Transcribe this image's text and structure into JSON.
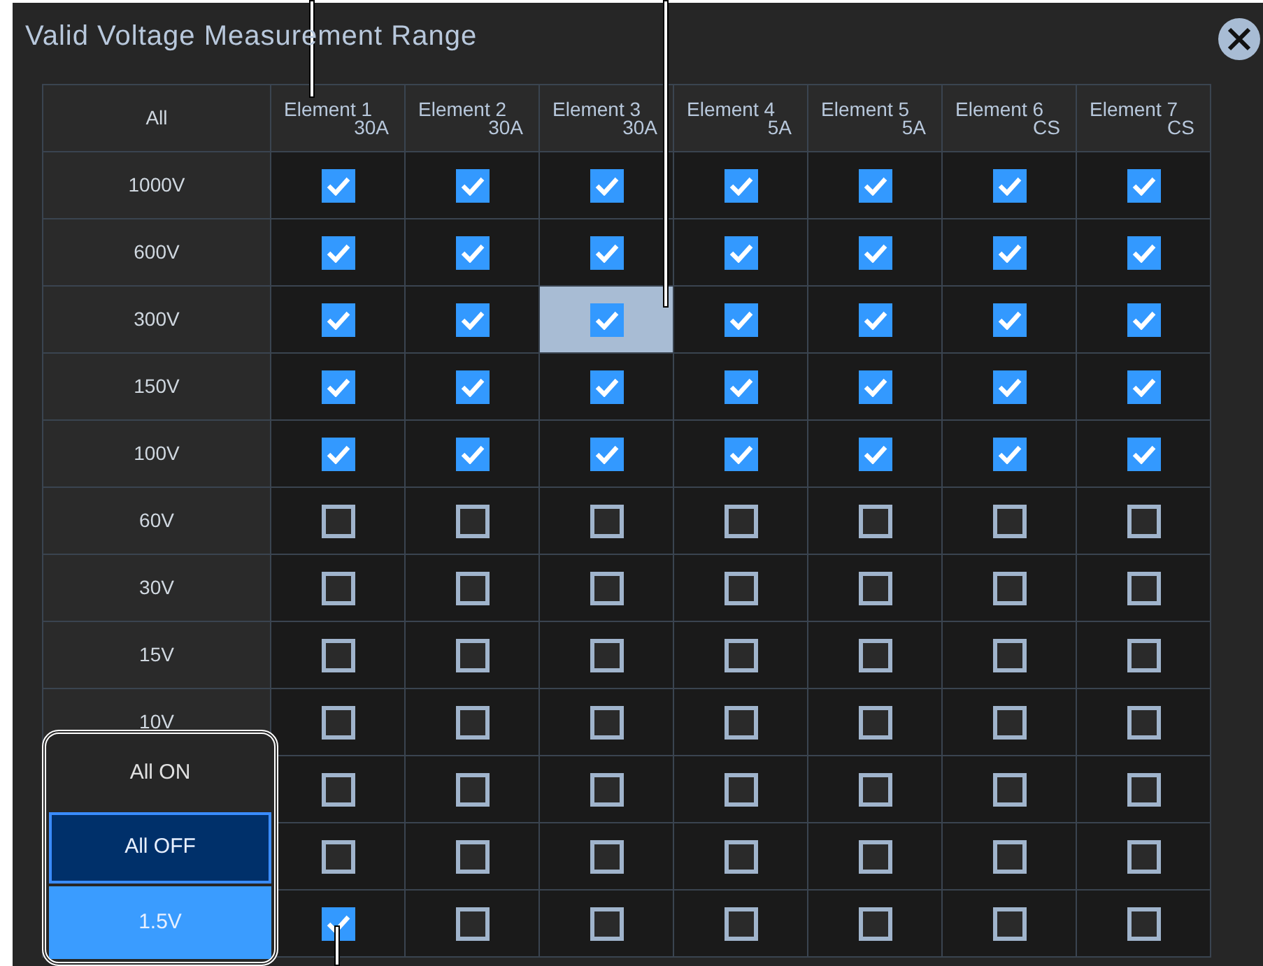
{
  "dialog": {
    "title": "Valid Voltage Measurement Range"
  },
  "table": {
    "corner": "All",
    "columns": [
      {
        "name": "Element 1",
        "rating": "30A"
      },
      {
        "name": "Element 2",
        "rating": "30A"
      },
      {
        "name": "Element 3",
        "rating": "30A"
      },
      {
        "name": "Element 4",
        "rating": "5A"
      },
      {
        "name": "Element 5",
        "rating": "5A"
      },
      {
        "name": "Element 6",
        "rating": "CS"
      },
      {
        "name": "Element 7",
        "rating": "CS"
      }
    ],
    "rows": [
      {
        "label": "1000V",
        "cells": [
          {
            "checked": true,
            "selected": false
          },
          {
            "checked": true,
            "selected": false
          },
          {
            "checked": true,
            "selected": false
          },
          {
            "checked": true,
            "selected": false
          },
          {
            "checked": true,
            "selected": false
          },
          {
            "checked": true,
            "selected": false
          },
          {
            "checked": true,
            "selected": false
          }
        ]
      },
      {
        "label": "600V",
        "cells": [
          {
            "checked": true,
            "selected": false
          },
          {
            "checked": true,
            "selected": false
          },
          {
            "checked": true,
            "selected": false
          },
          {
            "checked": true,
            "selected": false
          },
          {
            "checked": true,
            "selected": false
          },
          {
            "checked": true,
            "selected": false
          },
          {
            "checked": true,
            "selected": false
          }
        ]
      },
      {
        "label": "300V",
        "cells": [
          {
            "checked": true,
            "selected": false
          },
          {
            "checked": true,
            "selected": false
          },
          {
            "checked": true,
            "selected": true
          },
          {
            "checked": true,
            "selected": false
          },
          {
            "checked": true,
            "selected": false
          },
          {
            "checked": true,
            "selected": false
          },
          {
            "checked": true,
            "selected": false
          }
        ]
      },
      {
        "label": "150V",
        "cells": [
          {
            "checked": true,
            "selected": false
          },
          {
            "checked": true,
            "selected": false
          },
          {
            "checked": true,
            "selected": false
          },
          {
            "checked": true,
            "selected": false
          },
          {
            "checked": true,
            "selected": false
          },
          {
            "checked": true,
            "selected": false
          },
          {
            "checked": true,
            "selected": false
          }
        ]
      },
      {
        "label": "100V",
        "cells": [
          {
            "checked": true,
            "selected": false
          },
          {
            "checked": true,
            "selected": false
          },
          {
            "checked": true,
            "selected": false
          },
          {
            "checked": true,
            "selected": false
          },
          {
            "checked": true,
            "selected": false
          },
          {
            "checked": true,
            "selected": false
          },
          {
            "checked": true,
            "selected": false
          }
        ]
      },
      {
        "label": "60V",
        "cells": [
          {
            "checked": false,
            "selected": false
          },
          {
            "checked": false,
            "selected": false
          },
          {
            "checked": false,
            "selected": false
          },
          {
            "checked": false,
            "selected": false
          },
          {
            "checked": false,
            "selected": false
          },
          {
            "checked": false,
            "selected": false
          },
          {
            "checked": false,
            "selected": false
          }
        ]
      },
      {
        "label": "30V",
        "cells": [
          {
            "checked": false,
            "selected": false
          },
          {
            "checked": false,
            "selected": false
          },
          {
            "checked": false,
            "selected": false
          },
          {
            "checked": false,
            "selected": false
          },
          {
            "checked": false,
            "selected": false
          },
          {
            "checked": false,
            "selected": false
          },
          {
            "checked": false,
            "selected": false
          }
        ]
      },
      {
        "label": "15V",
        "cells": [
          {
            "checked": false,
            "selected": false
          },
          {
            "checked": false,
            "selected": false
          },
          {
            "checked": false,
            "selected": false
          },
          {
            "checked": false,
            "selected": false
          },
          {
            "checked": false,
            "selected": false
          },
          {
            "checked": false,
            "selected": false
          },
          {
            "checked": false,
            "selected": false
          }
        ]
      },
      {
        "label": "10V",
        "cells": [
          {
            "checked": false,
            "selected": false
          },
          {
            "checked": false,
            "selected": false
          },
          {
            "checked": false,
            "selected": false
          },
          {
            "checked": false,
            "selected": false
          },
          {
            "checked": false,
            "selected": false
          },
          {
            "checked": false,
            "selected": false
          },
          {
            "checked": false,
            "selected": false
          }
        ]
      },
      {
        "cells": [
          {
            "checked": false,
            "selected": false
          },
          {
            "checked": false,
            "selected": false
          },
          {
            "checked": false,
            "selected": false
          },
          {
            "checked": false,
            "selected": false
          },
          {
            "checked": false,
            "selected": false
          },
          {
            "checked": false,
            "selected": false
          },
          {
            "checked": false,
            "selected": false
          }
        ]
      },
      {
        "cells": [
          {
            "checked": false,
            "selected": false
          },
          {
            "checked": false,
            "selected": false
          },
          {
            "checked": false,
            "selected": false
          },
          {
            "checked": false,
            "selected": false
          },
          {
            "checked": false,
            "selected": false
          },
          {
            "checked": false,
            "selected": false
          },
          {
            "checked": false,
            "selected": false
          }
        ]
      },
      {
        "cells": [
          {
            "checked": true,
            "selected": false
          },
          {
            "checked": false,
            "selected": false
          },
          {
            "checked": false,
            "selected": false
          },
          {
            "checked": false,
            "selected": false
          },
          {
            "checked": false,
            "selected": false
          },
          {
            "checked": false,
            "selected": false
          },
          {
            "checked": false,
            "selected": false
          }
        ]
      }
    ]
  },
  "dropdown": {
    "options": [
      {
        "label": "All ON",
        "selected": false,
        "focused": false
      },
      {
        "label": "All OFF",
        "selected": false,
        "focused": true
      },
      {
        "label": "1.5V",
        "selected": true,
        "focused": false
      }
    ]
  }
}
